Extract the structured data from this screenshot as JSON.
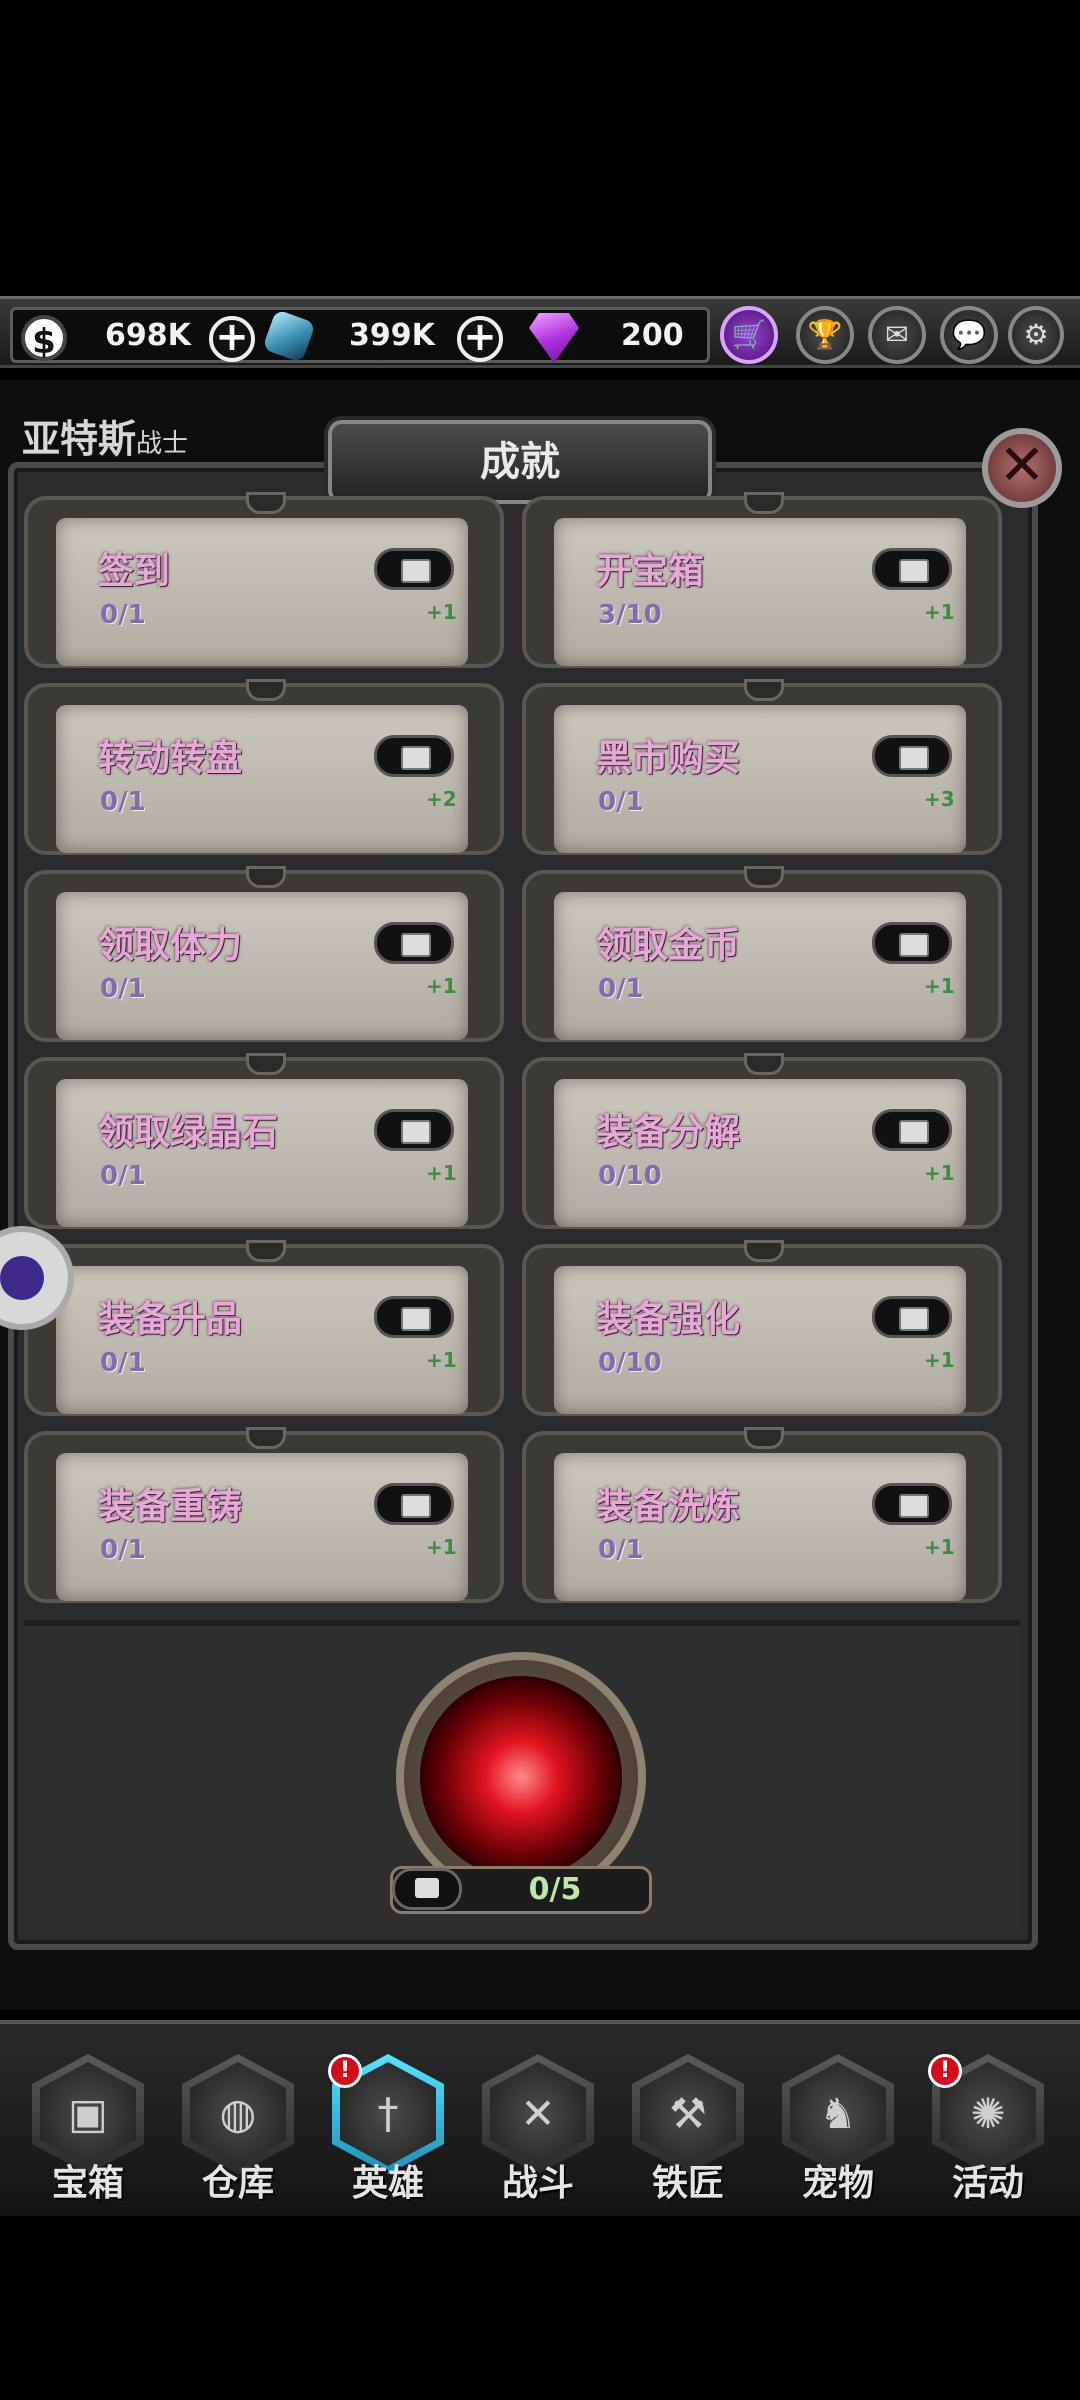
{
  "resources": [
    {
      "icon": "dollar-coin-icon",
      "value": "698K"
    },
    {
      "icon": "crystal-icon",
      "value": "399K"
    },
    {
      "icon": "purple-gem-icon",
      "value": "200"
    }
  ],
  "top_buttons": [
    "cart-icon",
    "trophy-icon",
    "mail-icon",
    "chat-icon",
    "gear-icon"
  ],
  "hero": {
    "name": "亚特斯",
    "class": "战士"
  },
  "modal": {
    "title": "成就",
    "achievements": [
      {
        "title": "签到",
        "progress": "0/1",
        "reward": "+1"
      },
      {
        "title": "开宝箱",
        "progress": "3/10",
        "reward": "+1"
      },
      {
        "title": "转动转盘",
        "progress": "0/1",
        "reward": "+2"
      },
      {
        "title": "黑市购买",
        "progress": "0/1",
        "reward": "+3"
      },
      {
        "title": "领取体力",
        "progress": "0/1",
        "reward": "+1"
      },
      {
        "title": "领取金币",
        "progress": "0/1",
        "reward": "+1"
      },
      {
        "title": "领取绿晶石",
        "progress": "0/1",
        "reward": "+1"
      },
      {
        "title": "装备分解",
        "progress": "0/10",
        "reward": "+1"
      },
      {
        "title": "装备升品",
        "progress": "0/1",
        "reward": "+1"
      },
      {
        "title": "装备强化",
        "progress": "0/10",
        "reward": "+1"
      },
      {
        "title": "装备重铸",
        "progress": "0/1",
        "reward": "+1"
      },
      {
        "title": "装备洗炼",
        "progress": "0/1",
        "reward": "+1"
      }
    ],
    "orb_progress": "0/5"
  },
  "nav": [
    {
      "label": "宝箱",
      "icon": "chest-icon",
      "badge": false,
      "active": false
    },
    {
      "label": "仓库",
      "icon": "backpack-icon",
      "badge": false,
      "active": false
    },
    {
      "label": "英雄",
      "icon": "sword-icon",
      "badge": true,
      "active": true
    },
    {
      "label": "战斗",
      "icon": "crossed-swords-icon",
      "badge": false,
      "active": false
    },
    {
      "label": "铁匠",
      "icon": "anvil-icon",
      "badge": false,
      "active": false
    },
    {
      "label": "宠物",
      "icon": "dragon-icon",
      "badge": false,
      "active": false
    },
    {
      "label": "活动",
      "icon": "swirl-icon",
      "badge": true,
      "active": false
    }
  ],
  "colors": {
    "title_pink": "#e6a8d6",
    "progress_purple": "#7b6fb0",
    "reward_green": "#3d8d3d",
    "orb_red": "#e2141e"
  }
}
